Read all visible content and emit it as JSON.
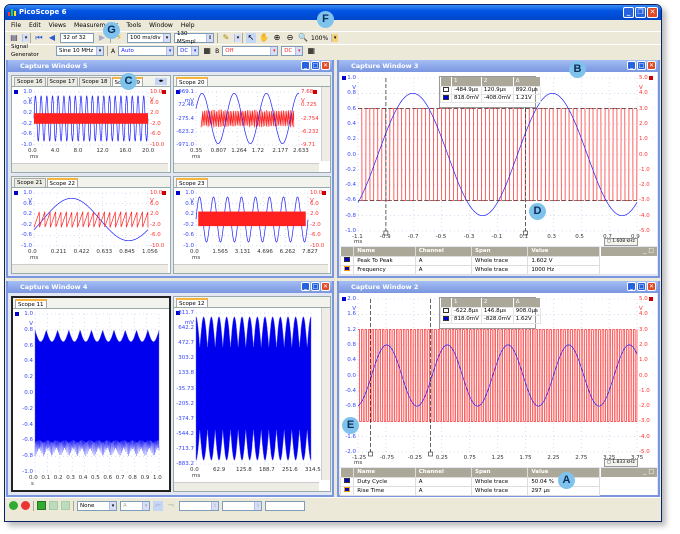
{
  "app": {
    "title": "PicoScope 6"
  },
  "menu": [
    "File",
    "Edit",
    "Views",
    "Measurements",
    "Tools",
    "Window",
    "Help"
  ],
  "toolbar": {
    "buffer": "32 of 32",
    "timebase": "100 ms/div",
    "samples": "130 MSmpl",
    "zoom": "100%",
    "siggen_label": "Signal Generator",
    "siggen_value": "Sine 10 MHz",
    "chA_label": "A",
    "chA_range": "Auto",
    "chA_coupling": "DC",
    "chB_label": "B",
    "chB_range": "Off",
    "chB_coupling": "DC"
  },
  "colors": {
    "channelA": "#2020ff",
    "channelB": "#ff2020",
    "title_blue": "#0054e3",
    "callout": "#7fc3ec"
  },
  "callouts": [
    "A",
    "B",
    "C",
    "D",
    "E",
    "F",
    "G"
  ],
  "windows": {
    "cw5": {
      "title": "Capture Window 5",
      "p1": {
        "tabs": [
          "Scope 16",
          "Scope 17",
          "Scope 18",
          "Scope 19"
        ],
        "left": [
          "1.0",
          "0.6",
          "0.2",
          "-0.2",
          "-0.6",
          "-1.0"
        ],
        "left_unit": "V",
        "right": [
          "10.0",
          "6.0",
          "2.0",
          "-2.0",
          "-6.0",
          "-10.0"
        ],
        "right_unit": "V",
        "x": [
          "0.0",
          "4.0",
          "8.0",
          "12.0",
          "16.0",
          "20.0"
        ],
        "x_unit": "ms"
      },
      "p2": {
        "tabs": [
          "Scope 20"
        ],
        "left": [
          "969.1",
          "72.46",
          "-275.4",
          "-623.2",
          "-971.0"
        ],
        "left_unit": "mV",
        "right": [
          "7.68",
          "0.725",
          "-2.754",
          "-6.232",
          "-9.71"
        ],
        "right_unit": "V",
        "x": [
          "0.35",
          "0.807",
          "1.264",
          "1.72",
          "2.177",
          "2.633"
        ],
        "x_unit": "ms"
      },
      "p3": {
        "tabs": [
          "Scope 21",
          "Scope 22"
        ],
        "left": [
          "1.0",
          "0.6",
          "0.2",
          "-0.2",
          "-0.6",
          "-1.0"
        ],
        "left_unit": "V",
        "right": [
          "10.0",
          "6.0",
          "2.0",
          "-2.0",
          "-6.0",
          "-10.0"
        ],
        "right_unit": "V",
        "x": [
          "0.0",
          "0.211",
          "0.422",
          "0.633",
          "0.845",
          "1.056"
        ],
        "x_unit": "ms"
      },
      "p4": {
        "tabs": [
          "Scope 23"
        ],
        "left": [
          "1.0",
          "0.6",
          "0.2",
          "-0.2",
          "-0.6",
          "-1.0"
        ],
        "left_unit": "V",
        "right": [
          "10.0",
          "6.0",
          "2.0",
          "-2.0",
          "-6.0",
          "-10.0"
        ],
        "right_unit": "V",
        "x": [
          "0.0",
          "1.565",
          "3.131",
          "4.696",
          "6.262",
          "7.827"
        ],
        "x_unit": "ms"
      }
    },
    "cw4": {
      "title": "Capture Window 4",
      "p1": {
        "tabs": [
          "Scope 11"
        ],
        "left": [
          "1.0",
          "0.8",
          "0.6",
          "0.4",
          "0.2",
          "0.0",
          "-0.2",
          "-0.4",
          "-0.6",
          "-0.8",
          "-1.0"
        ],
        "left_unit": "V",
        "right": [],
        "right_unit": "",
        "x": [
          "0.0",
          "0.1",
          "0.2",
          "0.3",
          "0.4",
          "0.5",
          "0.6",
          "0.7",
          "0.8",
          "0.9",
          "1.0"
        ],
        "x_unit": "s"
      },
      "p2": {
        "tabs": [
          "Scope 12"
        ],
        "left": [
          "811.7",
          "642.2",
          "472.7",
          "303.2",
          "133.8",
          "-35.73",
          "-205.2",
          "-374.7",
          "-544.2",
          "-713.7",
          "-883.2"
        ],
        "left_unit": "mV",
        "right": [],
        "right_unit": "",
        "x": [
          "0.0",
          "62.9",
          "125.8",
          "188.7",
          "251.6",
          "314.5"
        ],
        "x_unit": "ms"
      }
    },
    "cw3": {
      "title": "Capture Window 3",
      "p1": {
        "tabs": [],
        "left": [
          "1.0",
          "0.8",
          "0.6",
          "0.4",
          "0.2",
          "0.0",
          "-0.2",
          "-0.4",
          "-0.6",
          "-0.8",
          "-1.0"
        ],
        "left_unit": "V",
        "right": [
          "5.0",
          "4.0",
          "3.0",
          "2.0",
          "1.0",
          "0.0",
          "-1.0",
          "-2.0",
          "-3.0",
          "-4.0",
          "-5.0"
        ],
        "right_unit": "V",
        "x": [
          "-1.1",
          "-0.9",
          "-0.7",
          "-0.5",
          "-0.3",
          "-0.1",
          "0.1",
          "0.3",
          "0.5",
          "0.7",
          "0.9"
        ],
        "x_unit": "ms"
      },
      "ruler_freq": "1.608 kHz",
      "cursor_table": {
        "headers": [
          "1",
          "2",
          "Δ"
        ],
        "rows": [
          [
            "-484.9µs",
            "120.9µs",
            "892.0µs"
          ],
          [
            "818.0mV",
            "-408.0mV",
            "1.21V"
          ]
        ]
      },
      "measurements": {
        "headers": [
          "Name",
          "Channel",
          "Span",
          "Value"
        ],
        "rows": [
          [
            "Peak To Peak",
            "A",
            "Whole trace",
            "1.602 V"
          ],
          [
            "Frequency",
            "A",
            "Whole trace",
            "1000 Hz"
          ]
        ]
      }
    },
    "cw2": {
      "title": "Capture Window 2",
      "p1": {
        "tabs": [],
        "left": [
          "2.0",
          "1.6",
          "1.2",
          "0.8",
          "0.4",
          "0.0",
          "-0.4",
          "-0.8",
          "-1.2",
          "-1.6",
          "-2.0"
        ],
        "left_unit": "V",
        "right": [
          "5.0",
          "4.0",
          "3.0",
          "2.0",
          "1.0",
          "0.0",
          "-1.0",
          "-2.0",
          "-3.0",
          "-4.0",
          "-5.0"
        ],
        "right_unit": "V",
        "x": [
          "-1.25",
          "-0.75",
          "-0.25",
          "0.25",
          "0.75",
          "1.25",
          "1.75",
          "2.25",
          "2.75",
          "3.25",
          "3.75"
        ],
        "x_unit": "ms"
      },
      "ruler_freq": "1.833 kHz",
      "cursor_table": {
        "headers": [
          "1",
          "2",
          "Δ"
        ],
        "rows": [
          [
            "-622.8µs",
            "146.8µs",
            "908.0µs"
          ],
          [
            "818.0mV",
            "-828.0mV",
            "1.62V"
          ]
        ]
      },
      "measurements": {
        "headers": [
          "Name",
          "Channel",
          "Span",
          "Value"
        ],
        "rows": [
          [
            "Duty Cycle",
            "A",
            "Whole trace",
            "50.04 %"
          ],
          [
            "Rise Time",
            "A",
            "Whole trace",
            "297 µs"
          ]
        ]
      }
    }
  },
  "statusbar": {
    "trigger_mode": "None",
    "channel": "A"
  }
}
